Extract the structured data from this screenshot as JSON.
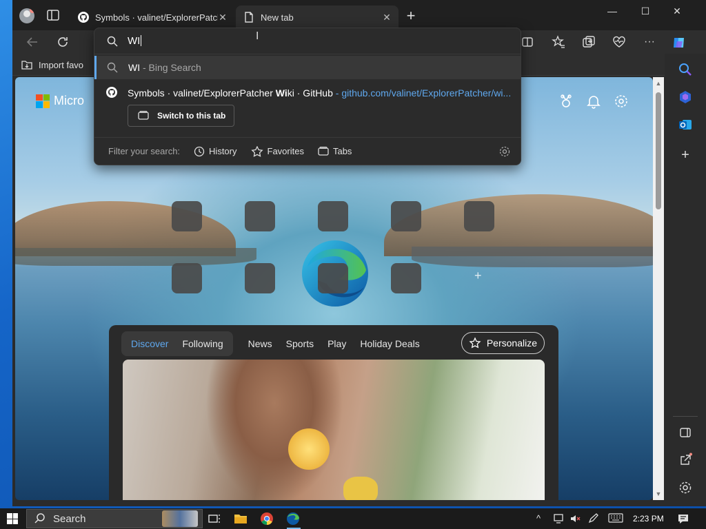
{
  "tabs": [
    {
      "label": "Symbols · valinet/ExplorerPatcher",
      "icon": "github-icon"
    },
    {
      "label": "New tab",
      "icon": "page-icon"
    }
  ],
  "favorites_bar": {
    "import_label": "Import favo"
  },
  "omnibox": {
    "query": "WI",
    "suggestion_search": {
      "term": "WI",
      "suffix": " - Bing Search"
    },
    "suggestion_tab": {
      "title_pre": "Symbols · valinet/ExplorerPatcher ",
      "title_bold": "Wi",
      "title_post": "ki · GitHub",
      "url": " - github.com/valinet/ExplorerPatcher/wi...",
      "switch_label": "Switch to this tab"
    },
    "filter": {
      "label": "Filter your search:",
      "history": "History",
      "favorites": "Favorites",
      "tabs": "Tabs"
    }
  },
  "newtab": {
    "brand": "Micro",
    "feed_tabs": [
      "Discover",
      "Following",
      "News",
      "Sports",
      "Play",
      "Holiday Deals"
    ],
    "personalize_label": "Personalize"
  },
  "taskbar": {
    "search_label": "Search",
    "time": "2:23 PM"
  },
  "colors": {
    "accent": "#5fa8ee",
    "edge_blue": "#0c59a4",
    "edge_green": "#54c251"
  }
}
